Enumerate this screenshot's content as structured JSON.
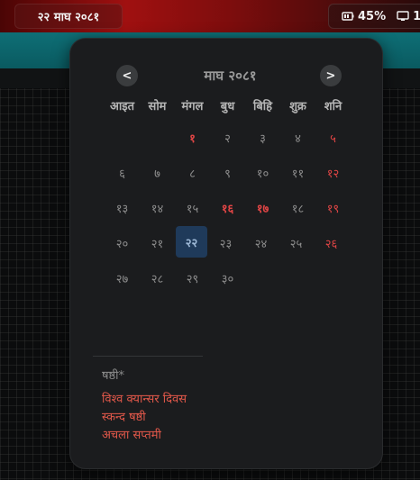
{
  "topbar": {
    "date": "२२ माघ २०८१",
    "battery_icon": "battery-icon",
    "battery_percent": "45%",
    "display_icon": "display-icon",
    "display_value": "1"
  },
  "calendar": {
    "month_title": "माघ २०८१",
    "prev_label": "<",
    "next_label": ">",
    "weekdays": [
      "आइत",
      "सोम",
      "मंगल",
      "बुध",
      "बिहि",
      "शुक्र",
      "शनि"
    ],
    "weeks": [
      [
        "",
        "",
        "१",
        "२",
        "३",
        "४",
        "५"
      ],
      [
        "६",
        "७",
        "८",
        "९",
        "१०",
        "११",
        "१२"
      ],
      [
        "१३",
        "१४",
        "१५",
        "१६",
        "१७",
        "१८",
        "१९"
      ],
      [
        "२०",
        "२१",
        "२२",
        "२३",
        "२४",
        "२५",
        "२६"
      ],
      [
        "२७",
        "२८",
        "२९",
        "३०",
        "",
        "",
        ""
      ]
    ],
    "holidays": [
      "१",
      "१६",
      "१७"
    ],
    "today": "२२",
    "colors": {
      "holiday": "#e04545",
      "today_bg": "#1f3a5a",
      "popup_bg": "#1b1c1e"
    }
  },
  "details": {
    "tithi": "षष्ठी*",
    "events": [
      "विश्व क्यान्सर दिवस",
      "स्कन्द षष्ठी",
      "अचला सप्तमी"
    ]
  }
}
